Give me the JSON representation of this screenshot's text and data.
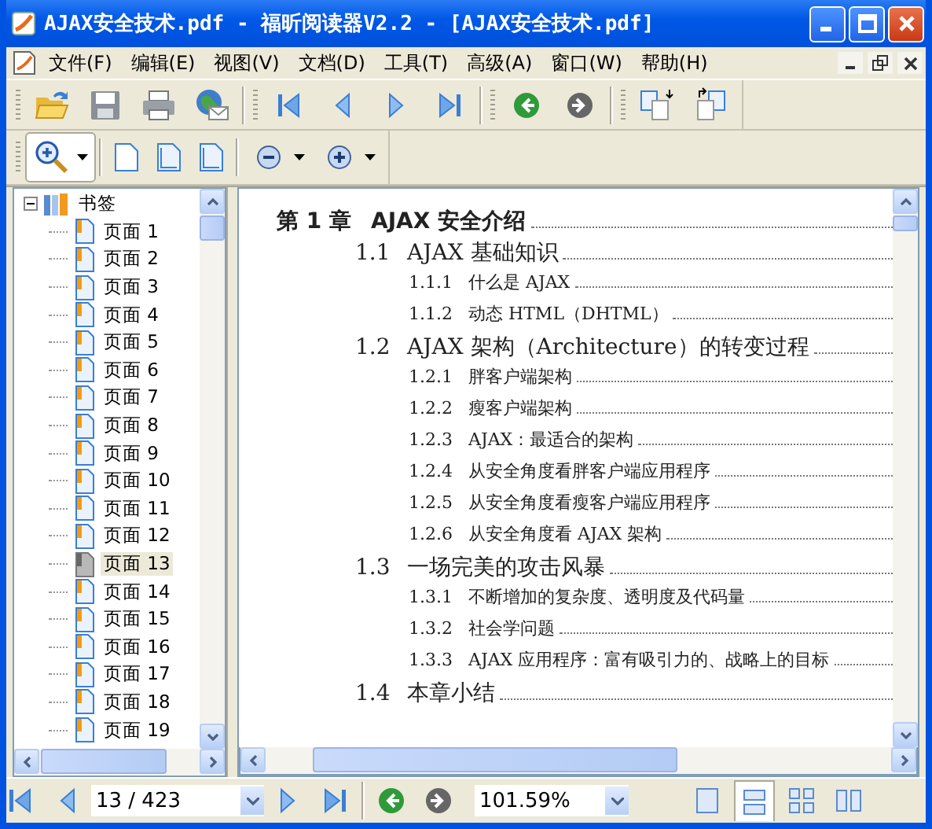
{
  "window": {
    "title": "AJAX安全技术.pdf - 福昕阅读器V2.2 - [AJAX安全技术.pdf]"
  },
  "menu": [
    "文件(F)",
    "编辑(E)",
    "视图(V)",
    "文档(D)",
    "工具(T)",
    "高级(A)",
    "窗口(W)",
    "帮助(H)"
  ],
  "bookmarks": {
    "label": "书签",
    "expanded": true,
    "children": [
      {
        "label": "页面 1",
        "selected": false
      },
      {
        "label": "页面 2",
        "selected": false
      },
      {
        "label": "页面 3",
        "selected": false
      },
      {
        "label": "页面 4",
        "selected": false
      },
      {
        "label": "页面 5",
        "selected": false
      },
      {
        "label": "页面 6",
        "selected": false
      },
      {
        "label": "页面 7",
        "selected": false
      },
      {
        "label": "页面 8",
        "selected": false
      },
      {
        "label": "页面 9",
        "selected": false
      },
      {
        "label": "页面 10",
        "selected": false
      },
      {
        "label": "页面 11",
        "selected": false
      },
      {
        "label": "页面 12",
        "selected": false
      },
      {
        "label": "页面 13",
        "selected": true
      },
      {
        "label": "页面 14",
        "selected": false
      },
      {
        "label": "页面 15",
        "selected": false
      },
      {
        "label": "页面 16",
        "selected": false
      },
      {
        "label": "页面 17",
        "selected": false
      },
      {
        "label": "页面 18",
        "selected": false
      },
      {
        "label": "页面 19",
        "selected": false
      }
    ]
  },
  "toc": [
    {
      "number": "第 1 章",
      "title": "AJAX 安全介绍",
      "children": [
        {
          "number": "1.1",
          "title": "AJAX 基础知识",
          "children": [
            {
              "number": "1.1.1",
              "title": "什么是 AJAX"
            },
            {
              "number": "1.1.2",
              "title": "动态 HTML（DHTML）"
            }
          ]
        },
        {
          "number": "1.2",
          "title": "AJAX 架构（Architecture）的转变过程",
          "children": [
            {
              "number": "1.2.1",
              "title": "胖客户端架构"
            },
            {
              "number": "1.2.2",
              "title": "瘦客户端架构"
            },
            {
              "number": "1.2.3",
              "title": "AJAX：最适合的架构"
            },
            {
              "number": "1.2.4",
              "title": "从安全角度看胖客户端应用程序"
            },
            {
              "number": "1.2.5",
              "title": "从安全角度看瘦客户端应用程序"
            },
            {
              "number": "1.2.6",
              "title": "从安全角度看 AJAX 架构"
            }
          ]
        },
        {
          "number": "1.3",
          "title": "一场完美的攻击风暴",
          "children": [
            {
              "number": "1.3.1",
              "title": "不断增加的复杂度、透明度及代码量"
            },
            {
              "number": "1.3.2",
              "title": "社会学问题"
            },
            {
              "number": "1.3.3",
              "title": "AJAX 应用程序：富有吸引力的、战略上的目标"
            }
          ]
        },
        {
          "number": "1.4",
          "title": "本章小结"
        }
      ]
    }
  ],
  "status_bar": {
    "page": "13 / 423",
    "zoom": "101.59%",
    "view_modes": [
      {
        "selected": false
      },
      {
        "selected": true
      },
      {
        "selected": false
      },
      {
        "selected": false
      }
    ]
  }
}
